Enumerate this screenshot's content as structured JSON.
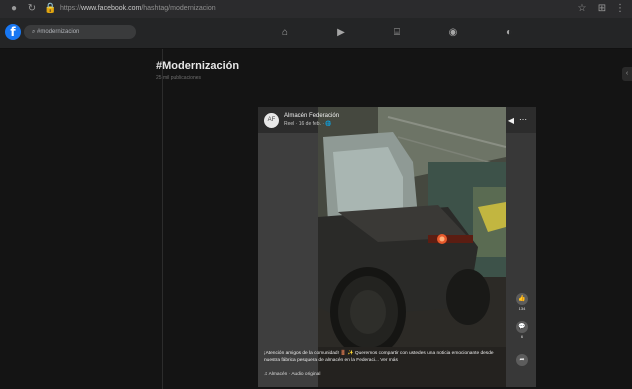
{
  "browser": {
    "url_prefix": "https://",
    "url_domain": "www.facebook.com",
    "url_path": "/hashtag/modernizacion",
    "back_icon": "reload-icon",
    "lock_icon": "lock-icon"
  },
  "facebook": {
    "logo": "f",
    "search_text": "#modernizacion",
    "nav_icons": [
      "home-icon",
      "video-icon",
      "marketplace-icon",
      "groups-icon",
      "gaming-icon"
    ]
  },
  "hashtag": {
    "title": "#Modernización",
    "subtitle": "25 mil publicaciones"
  },
  "post": {
    "page_name": "Almacén Federación",
    "meta": "Reel · 16 de feb. · 🌐",
    "avatar_text": "AF",
    "caption": "¡Atención amigos de la comunidad! 🚪 ✨ Queremos compartir con ustedes una noticia emocionante desde nuestra fábrica pesquera de almacén en la Federaci... Ver más",
    "audio": "♫ Almacén · Audio original",
    "actions": [
      {
        "icon": "like-icon",
        "glyph": "👍",
        "count": "134"
      },
      {
        "icon": "comment-icon",
        "glyph": "💬",
        "count": "6"
      },
      {
        "icon": "share-icon",
        "glyph": "➦",
        "count": ""
      }
    ]
  }
}
